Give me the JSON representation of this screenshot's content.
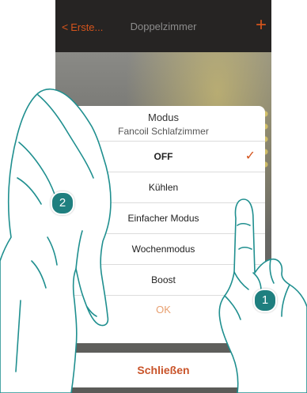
{
  "navbar": {
    "back_label": "Erste...",
    "title": "Doppelzimmer",
    "add_label": "+"
  },
  "modal": {
    "title": "Modus",
    "subtitle": "Fancoil Schlafzimmer",
    "options": [
      {
        "label": "OFF",
        "selected": true
      },
      {
        "label": "Kühlen",
        "selected": false
      },
      {
        "label": "Einfacher Modus",
        "selected": false
      },
      {
        "label": "Wochenmodus",
        "selected": false
      },
      {
        "label": "Boost",
        "selected": false
      }
    ],
    "check_mark": "✓",
    "ok_label": "OK"
  },
  "close_label": "Schließen",
  "badges": {
    "one": "1",
    "two": "2"
  },
  "colors": {
    "accent": "#d4541c",
    "badge": "#1f7f7f",
    "hand_stroke": "#1f8f8f"
  }
}
